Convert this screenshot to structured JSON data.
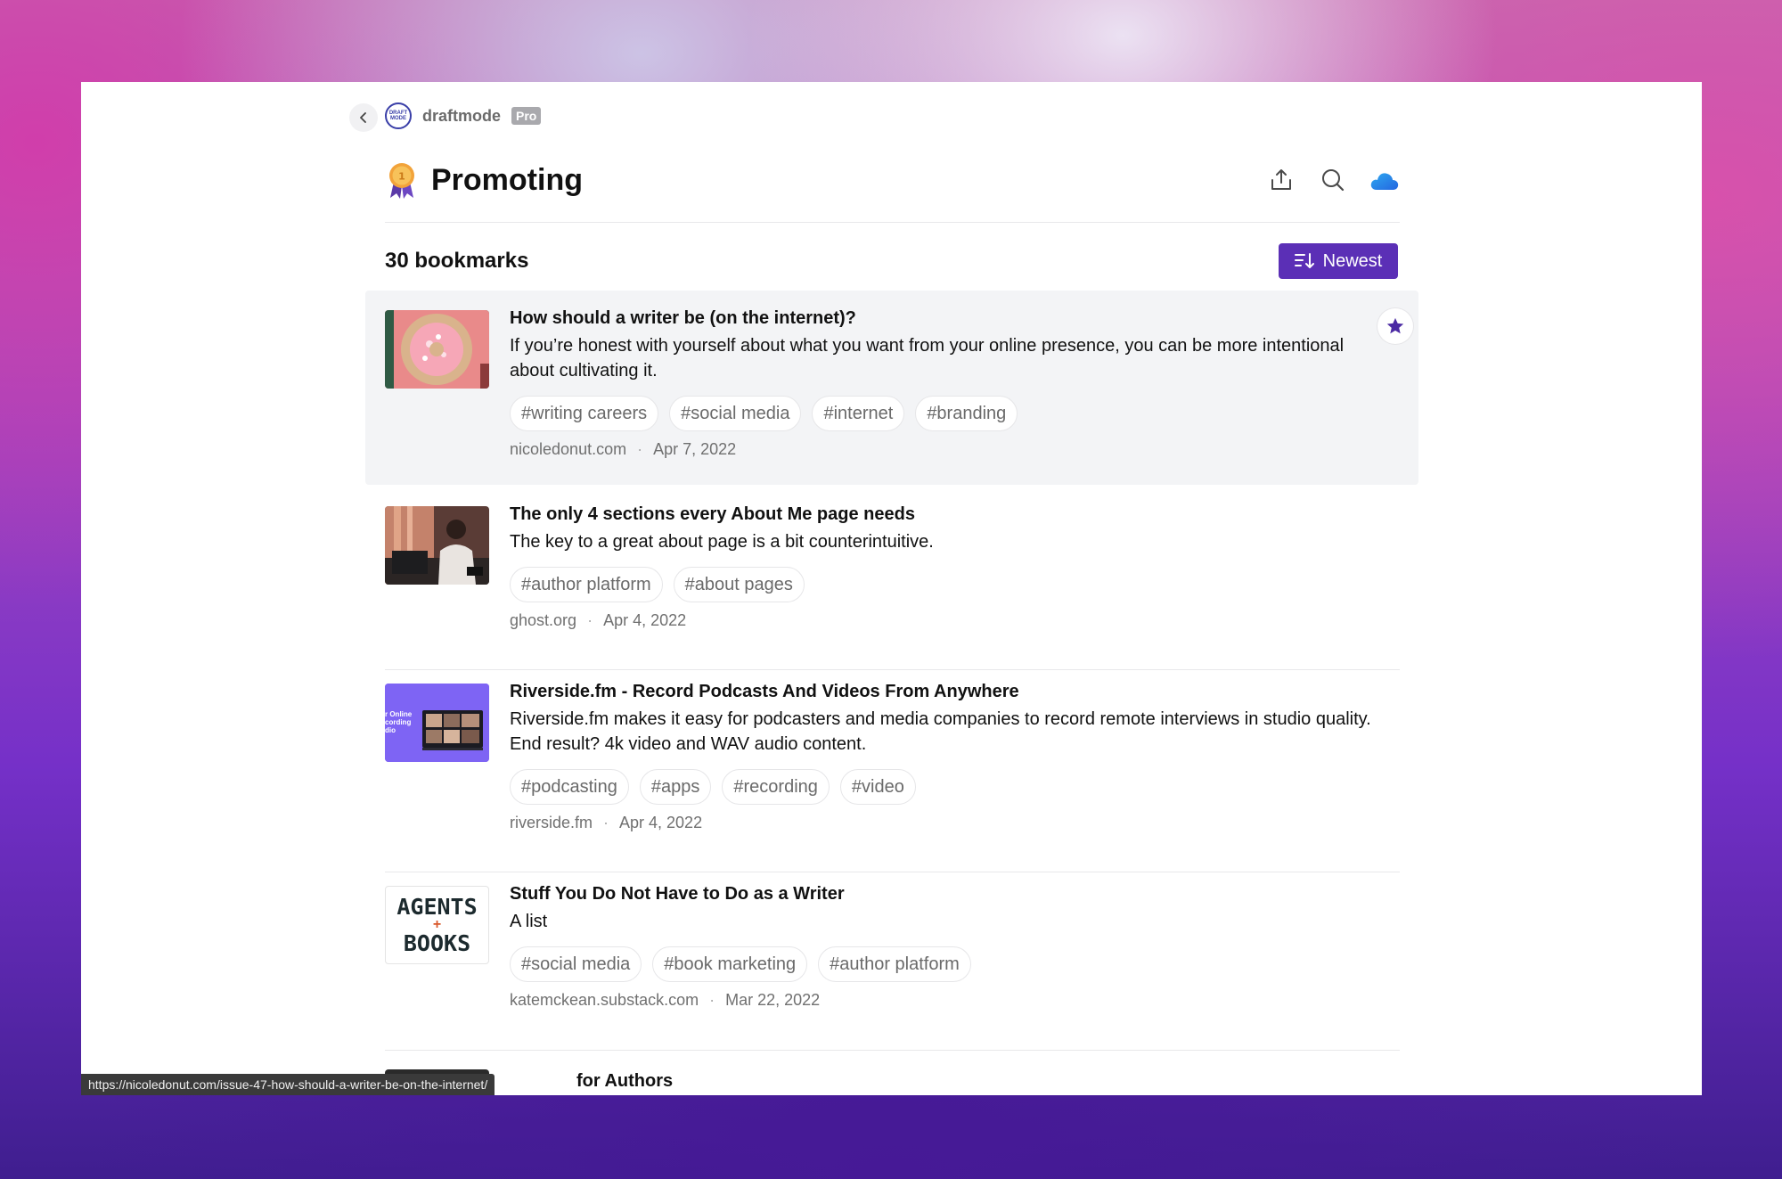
{
  "brand": {
    "name": "draftmode",
    "badge": "Pro",
    "logo_text_top": "DRAFT",
    "logo_text_bottom": "MODE"
  },
  "page": {
    "title": "Promoting",
    "emoji_icon": "medal-icon",
    "count_label": "30 bookmarks",
    "sort_label": "Newest"
  },
  "actions": [
    "share-icon",
    "search-icon",
    "icloud-icon"
  ],
  "bookmarks": [
    {
      "title": "How should a writer be (on the internet)?",
      "description": "If you’re honest with yourself about what you want from your online presence, you can be more intentional about cultivating it.",
      "tags": [
        "#writing careers",
        "#social media",
        "#internet",
        "#branding"
      ],
      "source": "nicoledonut.com",
      "date": "Apr 7, 2022",
      "starred": true
    },
    {
      "title": "The only 4 sections every About Me page needs",
      "description": "The key to a great about page is a bit counterintuitive.",
      "tags": [
        "#author platform",
        "#about pages"
      ],
      "source": "ghost.org",
      "date": "Apr 4, 2022"
    },
    {
      "title": "Riverside.fm - Record Podcasts And Videos From Anywhere",
      "description": "Riverside.fm makes it easy for podcasters and media companies to record remote interviews in studio quality. End result? 4k video and WAV audio content.",
      "tags": [
        "#podcasting",
        "#apps",
        "#recording",
        "#video"
      ],
      "source": "riverside.fm",
      "date": "Apr 4, 2022",
      "thumb_text": [
        "r Online",
        "cording",
        "dio"
      ]
    },
    {
      "title": "Stuff You Do Not Have to Do as a Writer",
      "description": "A list",
      "tags": [
        "#social media",
        "#book marketing",
        "#author platform"
      ],
      "source": "katemckean.substack.com",
      "date": "Mar 22, 2022",
      "thumb_text": [
        "AGENTS",
        "+",
        "BOOKS"
      ]
    }
  ],
  "partial_item_title": "for Authors",
  "status_bar_url": "https://nicoledonut.com/issue-47-how-should-a-writer-be-on-the-internet/"
}
